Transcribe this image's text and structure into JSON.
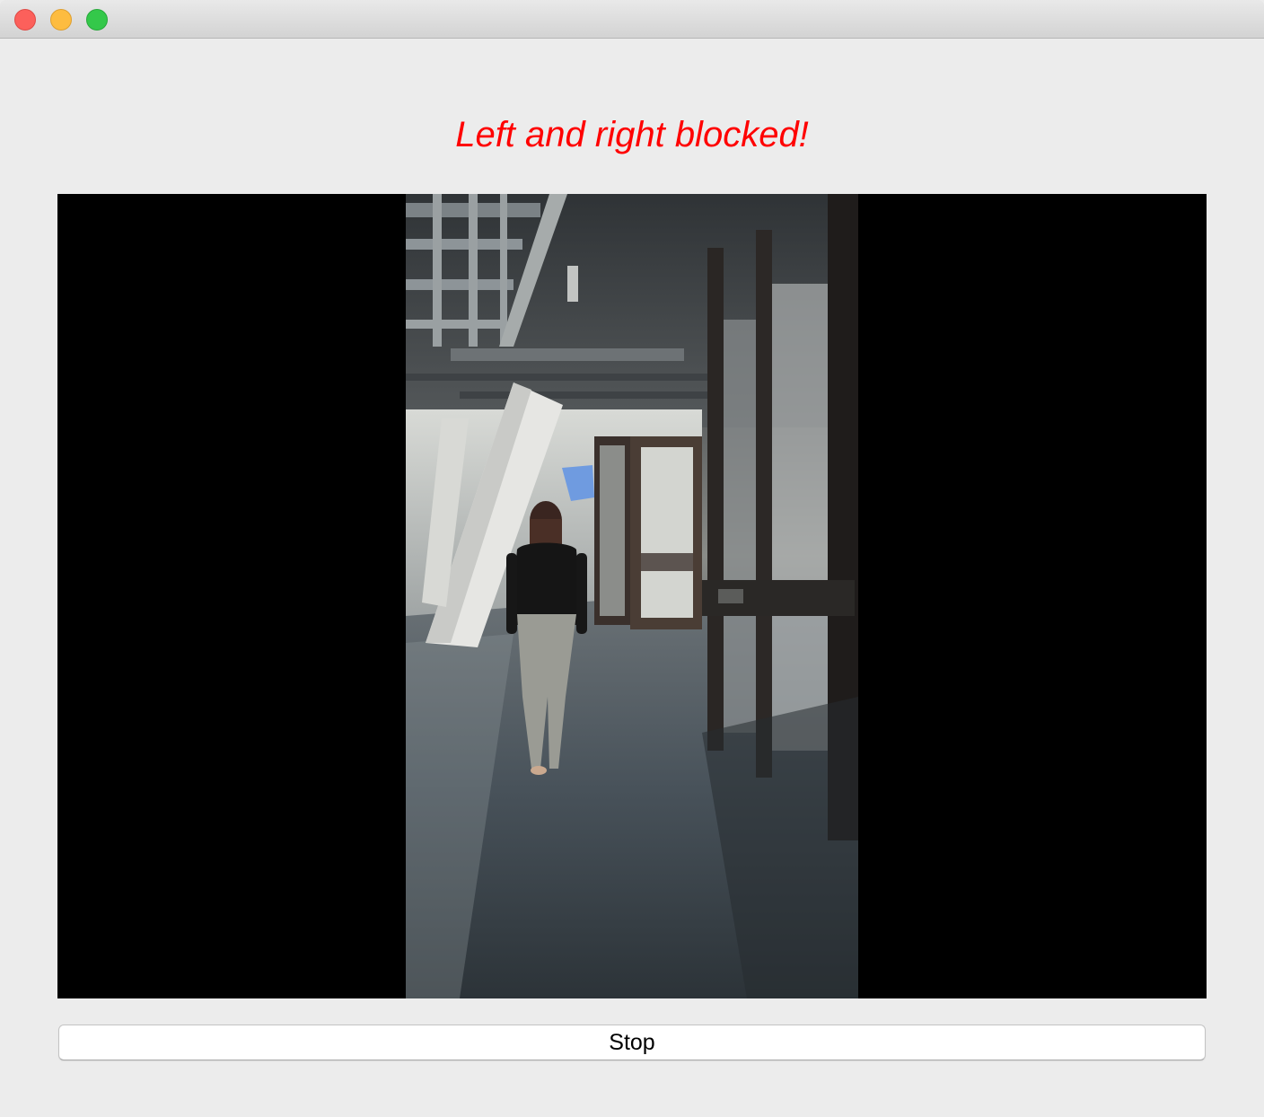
{
  "window": {
    "controls": {
      "close_icon": "close-icon",
      "minimize_icon": "minimize-icon",
      "zoom_icon": "zoom-icon"
    }
  },
  "status": {
    "message": "Left and right blocked!",
    "color": "#ff0000"
  },
  "video": {
    "background": "#000000"
  },
  "controls": {
    "stop_label": "Stop"
  }
}
